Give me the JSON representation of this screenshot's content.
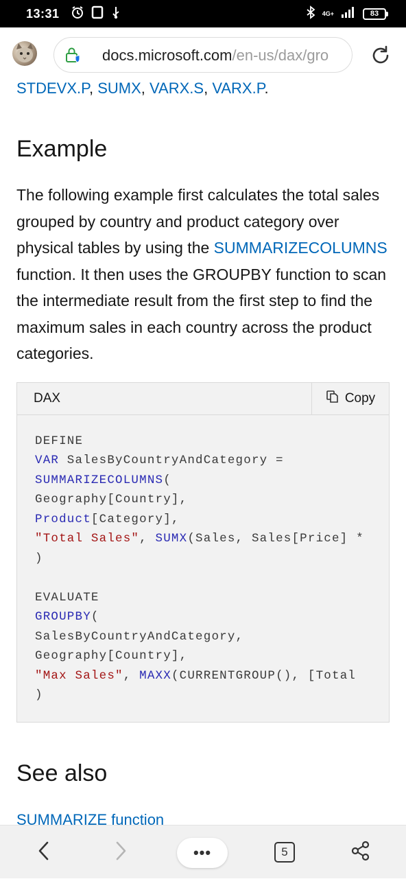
{
  "status_bar": {
    "time": "13:31",
    "network": "4G+",
    "battery": "83"
  },
  "address_bar": {
    "domain": "docs.microsoft.com",
    "path": "/en-us/dax/gro"
  },
  "intro_links": {
    "items": [
      "STDEVX.P",
      "SUMX",
      "VARX.S",
      "VARX.P"
    ]
  },
  "example": {
    "heading": "Example",
    "paragraph_start": "The following example first calculates the total sales grouped by country and product category over physical tables by using the ",
    "paragraph_link": "SUMMARIZECOLUMNS",
    "paragraph_end": " function. It then uses the GROUPBY function to scan the intermediate result from the first step to find the maximum sales in each country across the product categories."
  },
  "code": {
    "language": "DAX",
    "copy_label": "Copy",
    "lines": {
      "l1": "DEFINE",
      "l2_kw": "VAR",
      "l2_rest": " SalesByCountryAndCategory =",
      "l3_fn": "SUMMARIZECOLUMNS",
      "l3_rest": "(",
      "l4": "Geography[Country],",
      "l5_fn": "Product",
      "l5_rest": "[Category],",
      "l6_str": "\"Total Sales\"",
      "l6_mid": ", ",
      "l6_fn": "SUMX",
      "l6_rest": "(Sales, Sales[Price] *",
      "l7": ")",
      "l8": "EVALUATE",
      "l9_fn": "GROUPBY",
      "l9_rest": "(",
      "l10": "SalesByCountryAndCategory,",
      "l11": "Geography[Country],",
      "l12_str": "\"Max Sales\"",
      "l12_mid": ", ",
      "l12_fn": "MAXX",
      "l12_rest": "(CURRENTGROUP(), [Total",
      "l13": ")"
    }
  },
  "see_also": {
    "heading": "See also",
    "link": "SUMMARIZE function"
  },
  "bottom_nav": {
    "more_label": "•••",
    "tab_count": "5"
  },
  "colors": {
    "link": "#0067b8",
    "keyword": "#2a2ab3",
    "string": "#a31515",
    "code_bg": "#f2f2f2"
  }
}
